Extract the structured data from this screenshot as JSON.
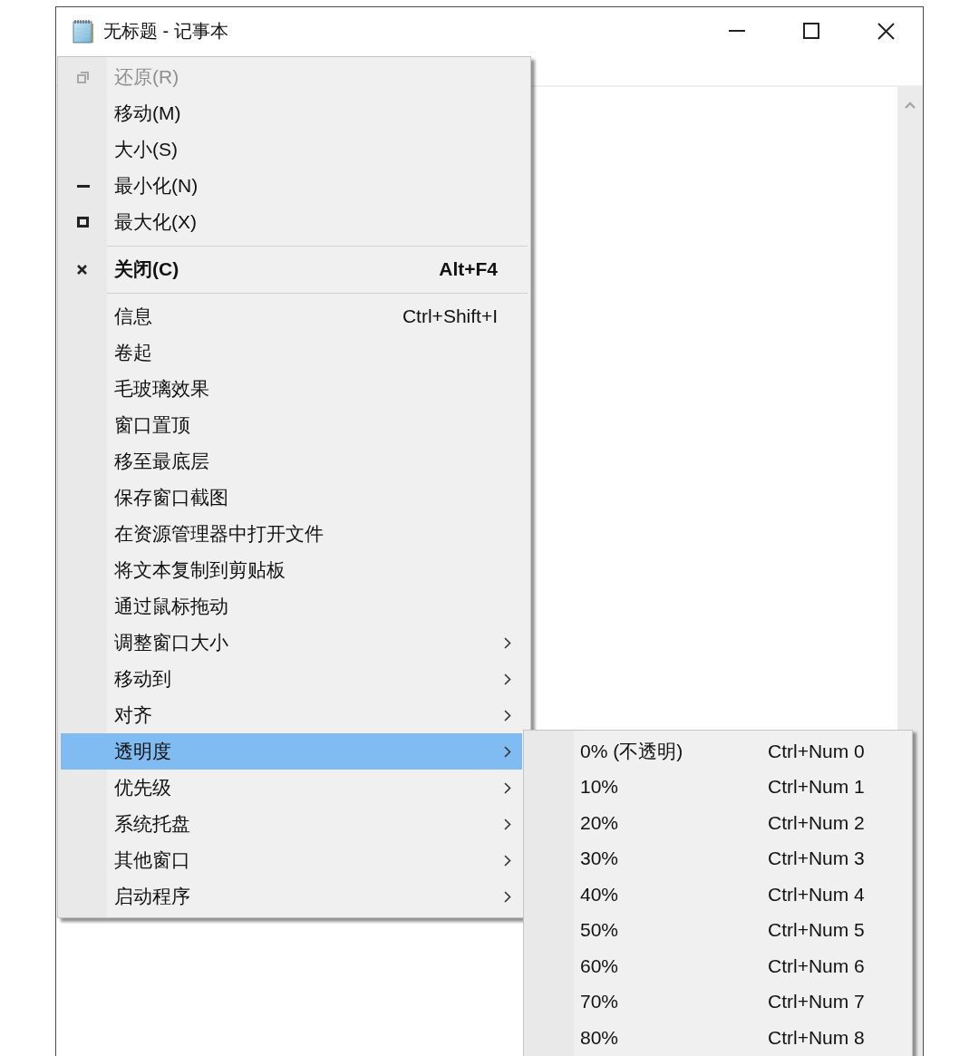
{
  "window": {
    "title": "无标题 - 记事本"
  },
  "system_menu": {
    "sections": [
      {
        "items": [
          {
            "kind": "restore",
            "label": "还原(R)",
            "disabled": true,
            "default": false,
            "has_submenu": false,
            "selected": false
          },
          {
            "kind": "plain",
            "label": "移动(M)",
            "disabled": false,
            "default": false,
            "has_submenu": false,
            "selected": false
          },
          {
            "kind": "plain",
            "label": "大小(S)",
            "disabled": false,
            "default": false,
            "has_submenu": false,
            "selected": false
          },
          {
            "kind": "minimize",
            "label": "最小化(N)",
            "disabled": false,
            "default": false,
            "has_submenu": false,
            "selected": false
          },
          {
            "kind": "maximize",
            "label": "最大化(X)",
            "disabled": false,
            "default": false,
            "has_submenu": false,
            "selected": false
          }
        ]
      },
      {
        "items": [
          {
            "kind": "close",
            "label": "关闭(C)",
            "shortcut": "Alt+F4",
            "disabled": false,
            "default": true,
            "has_submenu": false,
            "selected": false
          }
        ]
      },
      {
        "items": [
          {
            "kind": "plain",
            "label": "信息",
            "shortcut": "Ctrl+Shift+I",
            "disabled": false,
            "default": false,
            "has_submenu": false,
            "selected": false
          },
          {
            "kind": "plain",
            "label": "卷起",
            "disabled": false,
            "default": false,
            "has_submenu": false,
            "selected": false
          },
          {
            "kind": "plain",
            "label": "毛玻璃效果",
            "disabled": false,
            "default": false,
            "has_submenu": false,
            "selected": false
          },
          {
            "kind": "plain",
            "label": "窗口置顶",
            "disabled": false,
            "default": false,
            "has_submenu": false,
            "selected": false
          },
          {
            "kind": "plain",
            "label": "移至最底层",
            "disabled": false,
            "default": false,
            "has_submenu": false,
            "selected": false
          },
          {
            "kind": "plain",
            "label": "保存窗口截图",
            "disabled": false,
            "default": false,
            "has_submenu": false,
            "selected": false
          },
          {
            "kind": "plain",
            "label": "在资源管理器中打开文件",
            "disabled": false,
            "default": false,
            "has_submenu": false,
            "selected": false
          },
          {
            "kind": "plain",
            "label": "将文本复制到剪贴板",
            "disabled": false,
            "default": false,
            "has_submenu": false,
            "selected": false
          },
          {
            "kind": "plain",
            "label": "通过鼠标拖动",
            "disabled": false,
            "default": false,
            "has_submenu": false,
            "selected": false
          },
          {
            "kind": "plain",
            "label": "调整窗口大小",
            "disabled": false,
            "default": false,
            "has_submenu": true,
            "selected": false
          },
          {
            "kind": "plain",
            "label": "移动到",
            "disabled": false,
            "default": false,
            "has_submenu": true,
            "selected": false
          },
          {
            "kind": "plain",
            "label": "对齐",
            "disabled": false,
            "default": false,
            "has_submenu": true,
            "selected": false
          },
          {
            "kind": "plain",
            "label": "透明度",
            "disabled": false,
            "default": false,
            "has_submenu": true,
            "selected": true
          },
          {
            "kind": "plain",
            "label": "优先级",
            "disabled": false,
            "default": false,
            "has_submenu": true,
            "selected": false
          },
          {
            "kind": "plain",
            "label": "系统托盘",
            "disabled": false,
            "default": false,
            "has_submenu": true,
            "selected": false
          },
          {
            "kind": "plain",
            "label": "其他窗口",
            "disabled": false,
            "default": false,
            "has_submenu": true,
            "selected": false
          },
          {
            "kind": "plain",
            "label": "启动程序",
            "disabled": false,
            "default": false,
            "has_submenu": true,
            "selected": false
          }
        ]
      }
    ]
  },
  "transparency_submenu": {
    "items": [
      {
        "label": "0% (不透明)",
        "shortcut": "Ctrl+Num 0",
        "selected": false
      },
      {
        "label": "10%",
        "shortcut": "Ctrl+Num 1",
        "selected": false
      },
      {
        "label": "20%",
        "shortcut": "Ctrl+Num 2",
        "selected": false
      },
      {
        "label": "30%",
        "shortcut": "Ctrl+Num 3",
        "selected": false
      },
      {
        "label": "40%",
        "shortcut": "Ctrl+Num 4",
        "selected": false
      },
      {
        "label": "50%",
        "shortcut": "Ctrl+Num 5",
        "selected": false
      },
      {
        "label": "60%",
        "shortcut": "Ctrl+Num 6",
        "selected": false
      },
      {
        "label": "70%",
        "shortcut": "Ctrl+Num 7",
        "selected": false
      },
      {
        "label": "80%",
        "shortcut": "Ctrl+Num 8",
        "selected": false
      }
    ]
  }
}
